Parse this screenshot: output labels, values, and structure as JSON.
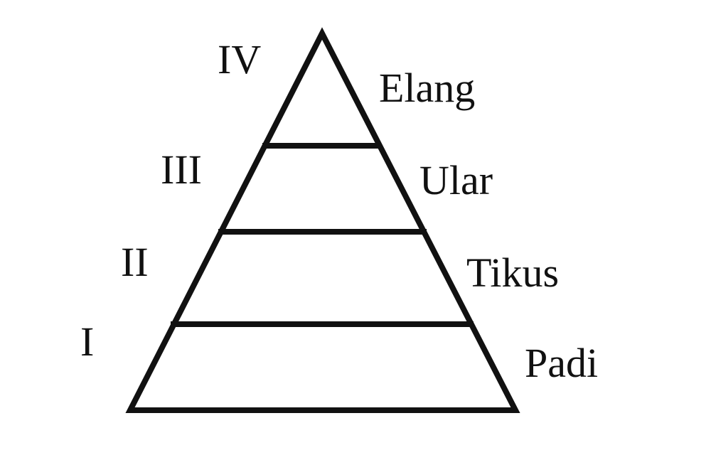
{
  "pyramid": {
    "levels": [
      {
        "numeral": "I",
        "organism": "Padi"
      },
      {
        "numeral": "II",
        "organism": "Tikus"
      },
      {
        "numeral": "III",
        "organism": "Ular"
      },
      {
        "numeral": "IV",
        "organism": "Elang"
      }
    ]
  },
  "colors": {
    "line": "#111111",
    "text": "#111111",
    "background": "#ffffff"
  }
}
